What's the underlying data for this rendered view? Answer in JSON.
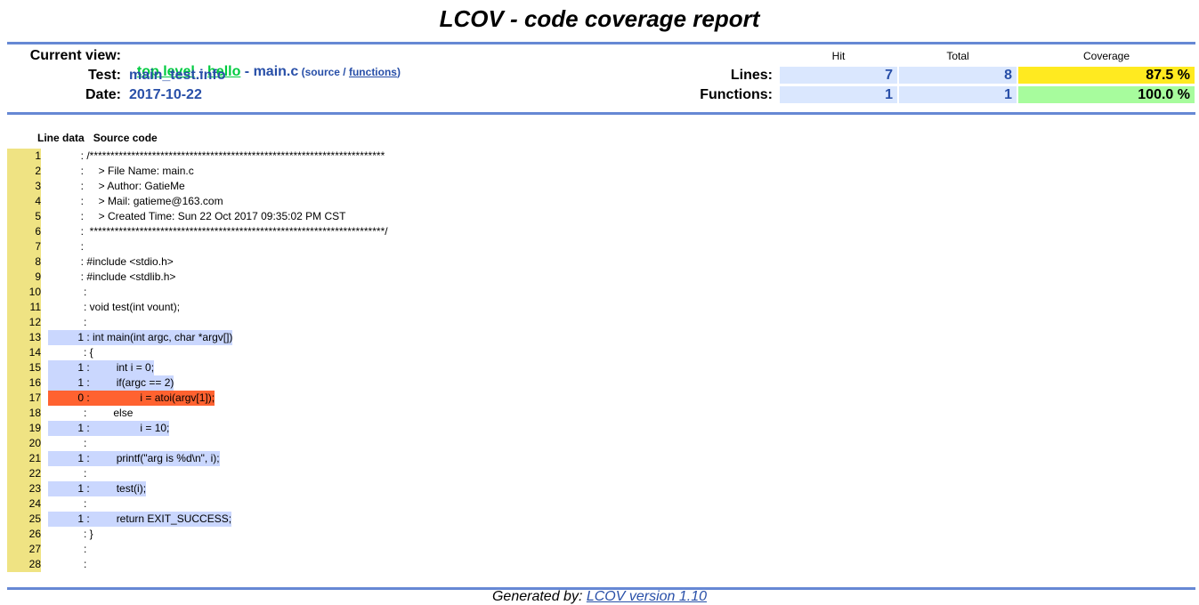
{
  "title": "LCOV - code coverage report",
  "header": {
    "current_view_label": "Current view:",
    "crumb_top": "top level",
    "crumb_sep1": " - ",
    "crumb_dir": "hello",
    "crumb_sep2": " - ",
    "crumb_file": "main.c",
    "paren_open": " (",
    "source_link": "source",
    "slash": " / ",
    "functions_link": "functions",
    "paren_close": ")",
    "test_label": "Test:",
    "test_value": "main_test.info",
    "date_label": "Date:",
    "date_value": "2017-10-22"
  },
  "summary": {
    "col_hit": "Hit",
    "col_total": "Total",
    "col_coverage": "Coverage",
    "lines_label": "Lines:",
    "lines_hit": "7",
    "lines_total": "8",
    "lines_cov": "87.5 %",
    "functions_label": "Functions:",
    "functions_hit": "1",
    "functions_total": "1",
    "functions_cov": "100.0 %"
  },
  "source": {
    "col_line_data": "Line data",
    "col_source": "Source code",
    "lines": [
      {
        "n": "1",
        "text": "           : /***********************************************************************"
      },
      {
        "n": "2",
        "text": "           :     > File Name: main.c"
      },
      {
        "n": "3",
        "text": "           :     > Author: GatieMe"
      },
      {
        "n": "4",
        "text": "           :     > Mail: gatieme@163.com"
      },
      {
        "n": "5",
        "text": "           :     > Created Time: Sun 22 Oct 2017 09:35:02 PM CST"
      },
      {
        "n": "6",
        "text": "           :  ***********************************************************************/"
      },
      {
        "n": "7",
        "text": "           :"
      },
      {
        "n": "8",
        "text": "           : #include <stdio.h>"
      },
      {
        "n": "9",
        "text": "           : #include <stdlib.h>"
      },
      {
        "n": "10",
        "text": "            :"
      },
      {
        "n": "11",
        "text": "            : void test(int vount);"
      },
      {
        "n": "12",
        "text": "            :"
      },
      {
        "n": "13",
        "text": "          1 : int main(int argc, char *argv[])",
        "state": "hit"
      },
      {
        "n": "14",
        "text": "            : {"
      },
      {
        "n": "15",
        "text": "          1 :         int i = 0;",
        "state": "hit"
      },
      {
        "n": "16",
        "text": "          1 :         if(argc == 2)",
        "state": "hit"
      },
      {
        "n": "17",
        "text": "          0 :                 i = atoi(argv[1]);",
        "state": "miss"
      },
      {
        "n": "18",
        "text": "            :         else"
      },
      {
        "n": "19",
        "text": "          1 :                 i = 10;",
        "state": "hit"
      },
      {
        "n": "20",
        "text": "            :"
      },
      {
        "n": "21",
        "text": "          1 :         printf(\"arg is %d\\n\", i);",
        "state": "hit"
      },
      {
        "n": "22",
        "text": "            :"
      },
      {
        "n": "23",
        "text": "          1 :         test(i);",
        "state": "hit"
      },
      {
        "n": "24",
        "text": "            :"
      },
      {
        "n": "25",
        "text": "          1 :         return EXIT_SUCCESS;",
        "state": "hit"
      },
      {
        "n": "26",
        "text": "            : }"
      },
      {
        "n": "27",
        "text": "            :"
      },
      {
        "n": "28",
        "text": "            :"
      }
    ]
  },
  "footer": {
    "generated_by": "Generated by: ",
    "lcov_link": "LCOV version 1.10"
  },
  "colors": {
    "accent_blue": "#284fa8",
    "rule": "#6688d4",
    "line_num_bg": "#efe383",
    "hit_bg": "#cad7fe",
    "miss_bg": "#ff6230",
    "cov_medium": "#ffea20",
    "cov_high": "#a7fc9d"
  }
}
